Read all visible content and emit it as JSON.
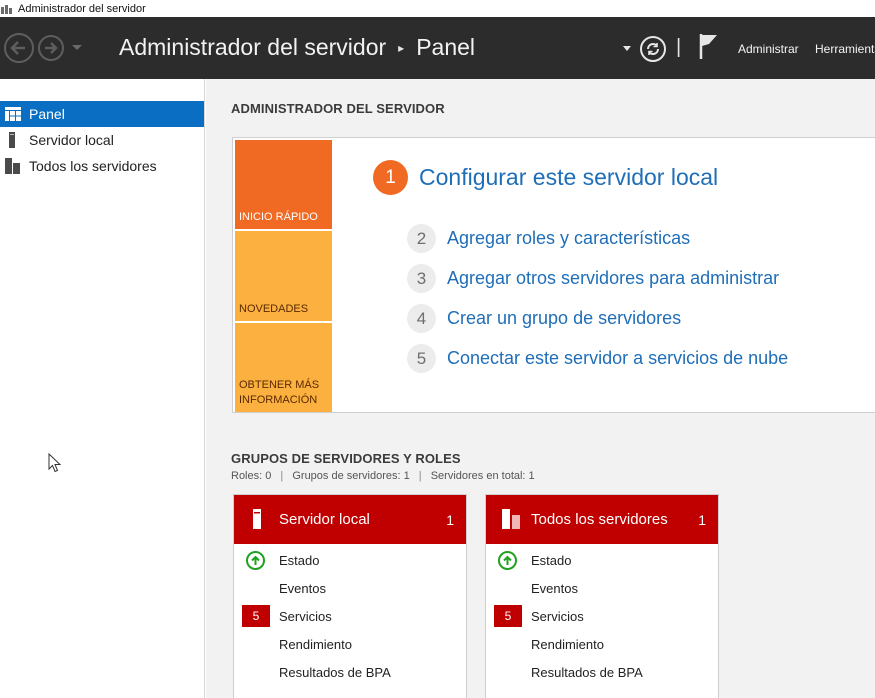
{
  "window": {
    "title": "Administrador del servidor"
  },
  "header": {
    "app_name": "Administrador del servidor",
    "separator": "▸",
    "page": "Panel",
    "menu": {
      "manage": "Administrar",
      "tools": "Herramientas"
    }
  },
  "sidebar": {
    "items": [
      {
        "label": "Panel",
        "active": true,
        "icon": "dashboard-icon"
      },
      {
        "label": "Servidor local",
        "active": false,
        "icon": "server-icon"
      },
      {
        "label": "Todos los servidores",
        "active": false,
        "icon": "servers-icon"
      }
    ]
  },
  "main": {
    "heading": "ADMINISTRADOR DEL SERVIDOR",
    "welcome": {
      "tiles": [
        "INICIO RÁPIDO",
        "NOVEDADES",
        "OBTENER MÁS INFORMACIÓN"
      ],
      "steps": [
        {
          "num": "1",
          "label": "Configurar este servidor local"
        },
        {
          "num": "2",
          "label": "Agregar roles y características"
        },
        {
          "num": "3",
          "label": "Agregar otros servidores para administrar"
        },
        {
          "num": "4",
          "label": "Crear un grupo de servidores"
        },
        {
          "num": "5",
          "label": "Conectar este servidor a servicios de nube"
        }
      ]
    },
    "groups": {
      "heading": "GRUPOS DE SERVIDORES Y ROLES",
      "summary": {
        "roles": "Roles: 0",
        "groups": "Grupos de servidores: 1",
        "total": "Servidores en total: 1",
        "separator": "|"
      },
      "cards": [
        {
          "title": "Servidor local",
          "count": "1",
          "rows": {
            "status": "Estado",
            "events": "Eventos",
            "services_badge": "5",
            "services": "Servicios",
            "performance": "Rendimiento",
            "bpa": "Resultados de BPA"
          }
        },
        {
          "title": "Todos los servidores",
          "count": "1",
          "rows": {
            "status": "Estado",
            "events": "Eventos",
            "services_badge": "5",
            "services": "Servicios",
            "performance": "Rendimiento",
            "bpa": "Resultados de BPA"
          }
        }
      ]
    }
  },
  "colors": {
    "header_bg": "#2c2c2c",
    "nav_active": "#0a6fc2",
    "quickstart_tile": "#f06a23",
    "info_tiles": "#fbb040",
    "link": "#1f6eb8",
    "card_header": "#c00000",
    "status_ok": "#21a121"
  }
}
